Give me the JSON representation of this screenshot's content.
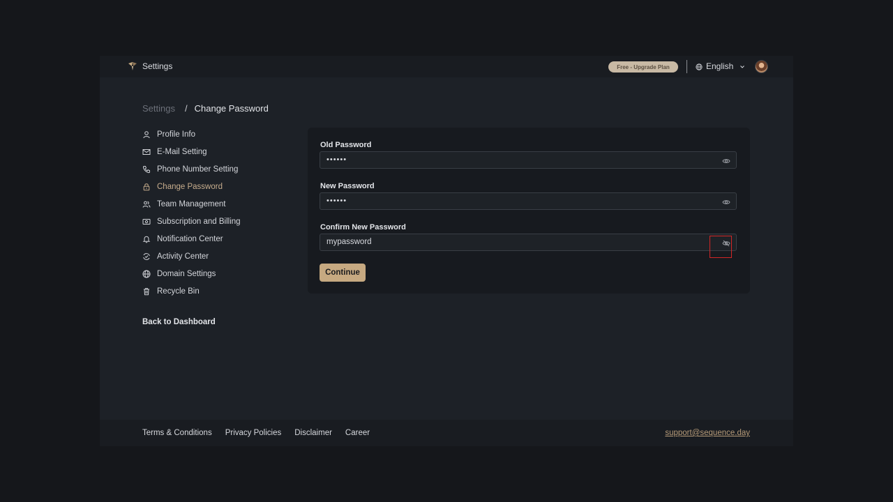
{
  "app": {
    "title": "Settings"
  },
  "topbar": {
    "plan_badge": "Free - Upgrade Plan",
    "language": "English"
  },
  "breadcrumb": {
    "root": "Settings",
    "separator": "/",
    "current": "Change Password"
  },
  "sidebar": {
    "items": [
      {
        "label": "Profile Info",
        "icon": "user-icon"
      },
      {
        "label": "E-Mail Setting",
        "icon": "mail-icon"
      },
      {
        "label": "Phone Number Setting",
        "icon": "phone-icon"
      },
      {
        "label": "Change Password",
        "icon": "lock-icon",
        "active": true
      },
      {
        "label": "Team Management",
        "icon": "team-icon"
      },
      {
        "label": "Subscription and Billing",
        "icon": "billing-icon"
      },
      {
        "label": "Notification Center",
        "icon": "bell-icon"
      },
      {
        "label": "Activity Center",
        "icon": "activity-icon"
      },
      {
        "label": "Domain Settings",
        "icon": "globe-icon"
      },
      {
        "label": "Recycle Bin",
        "icon": "trash-icon"
      }
    ],
    "back_label": "Back to Dashboard"
  },
  "form": {
    "old_password": {
      "label": "Old Password",
      "value": "••••••",
      "visible": false
    },
    "new_password": {
      "label": "New Password",
      "value": "••••••",
      "visible": false
    },
    "confirm_password": {
      "label": "Confirm New Password",
      "value": "mypassword",
      "visible": true
    },
    "submit_label": "Continue"
  },
  "footer": {
    "links": [
      "Terms & Conditions",
      "Privacy Policies",
      "Disclaimer",
      "Career"
    ],
    "support_email": "support@sequence.day"
  },
  "colors": {
    "accent": "#c6a981",
    "active_menu": "#c7ad8d",
    "background": "#1d2127",
    "card": "#171a1f",
    "highlight": "#d32626"
  }
}
